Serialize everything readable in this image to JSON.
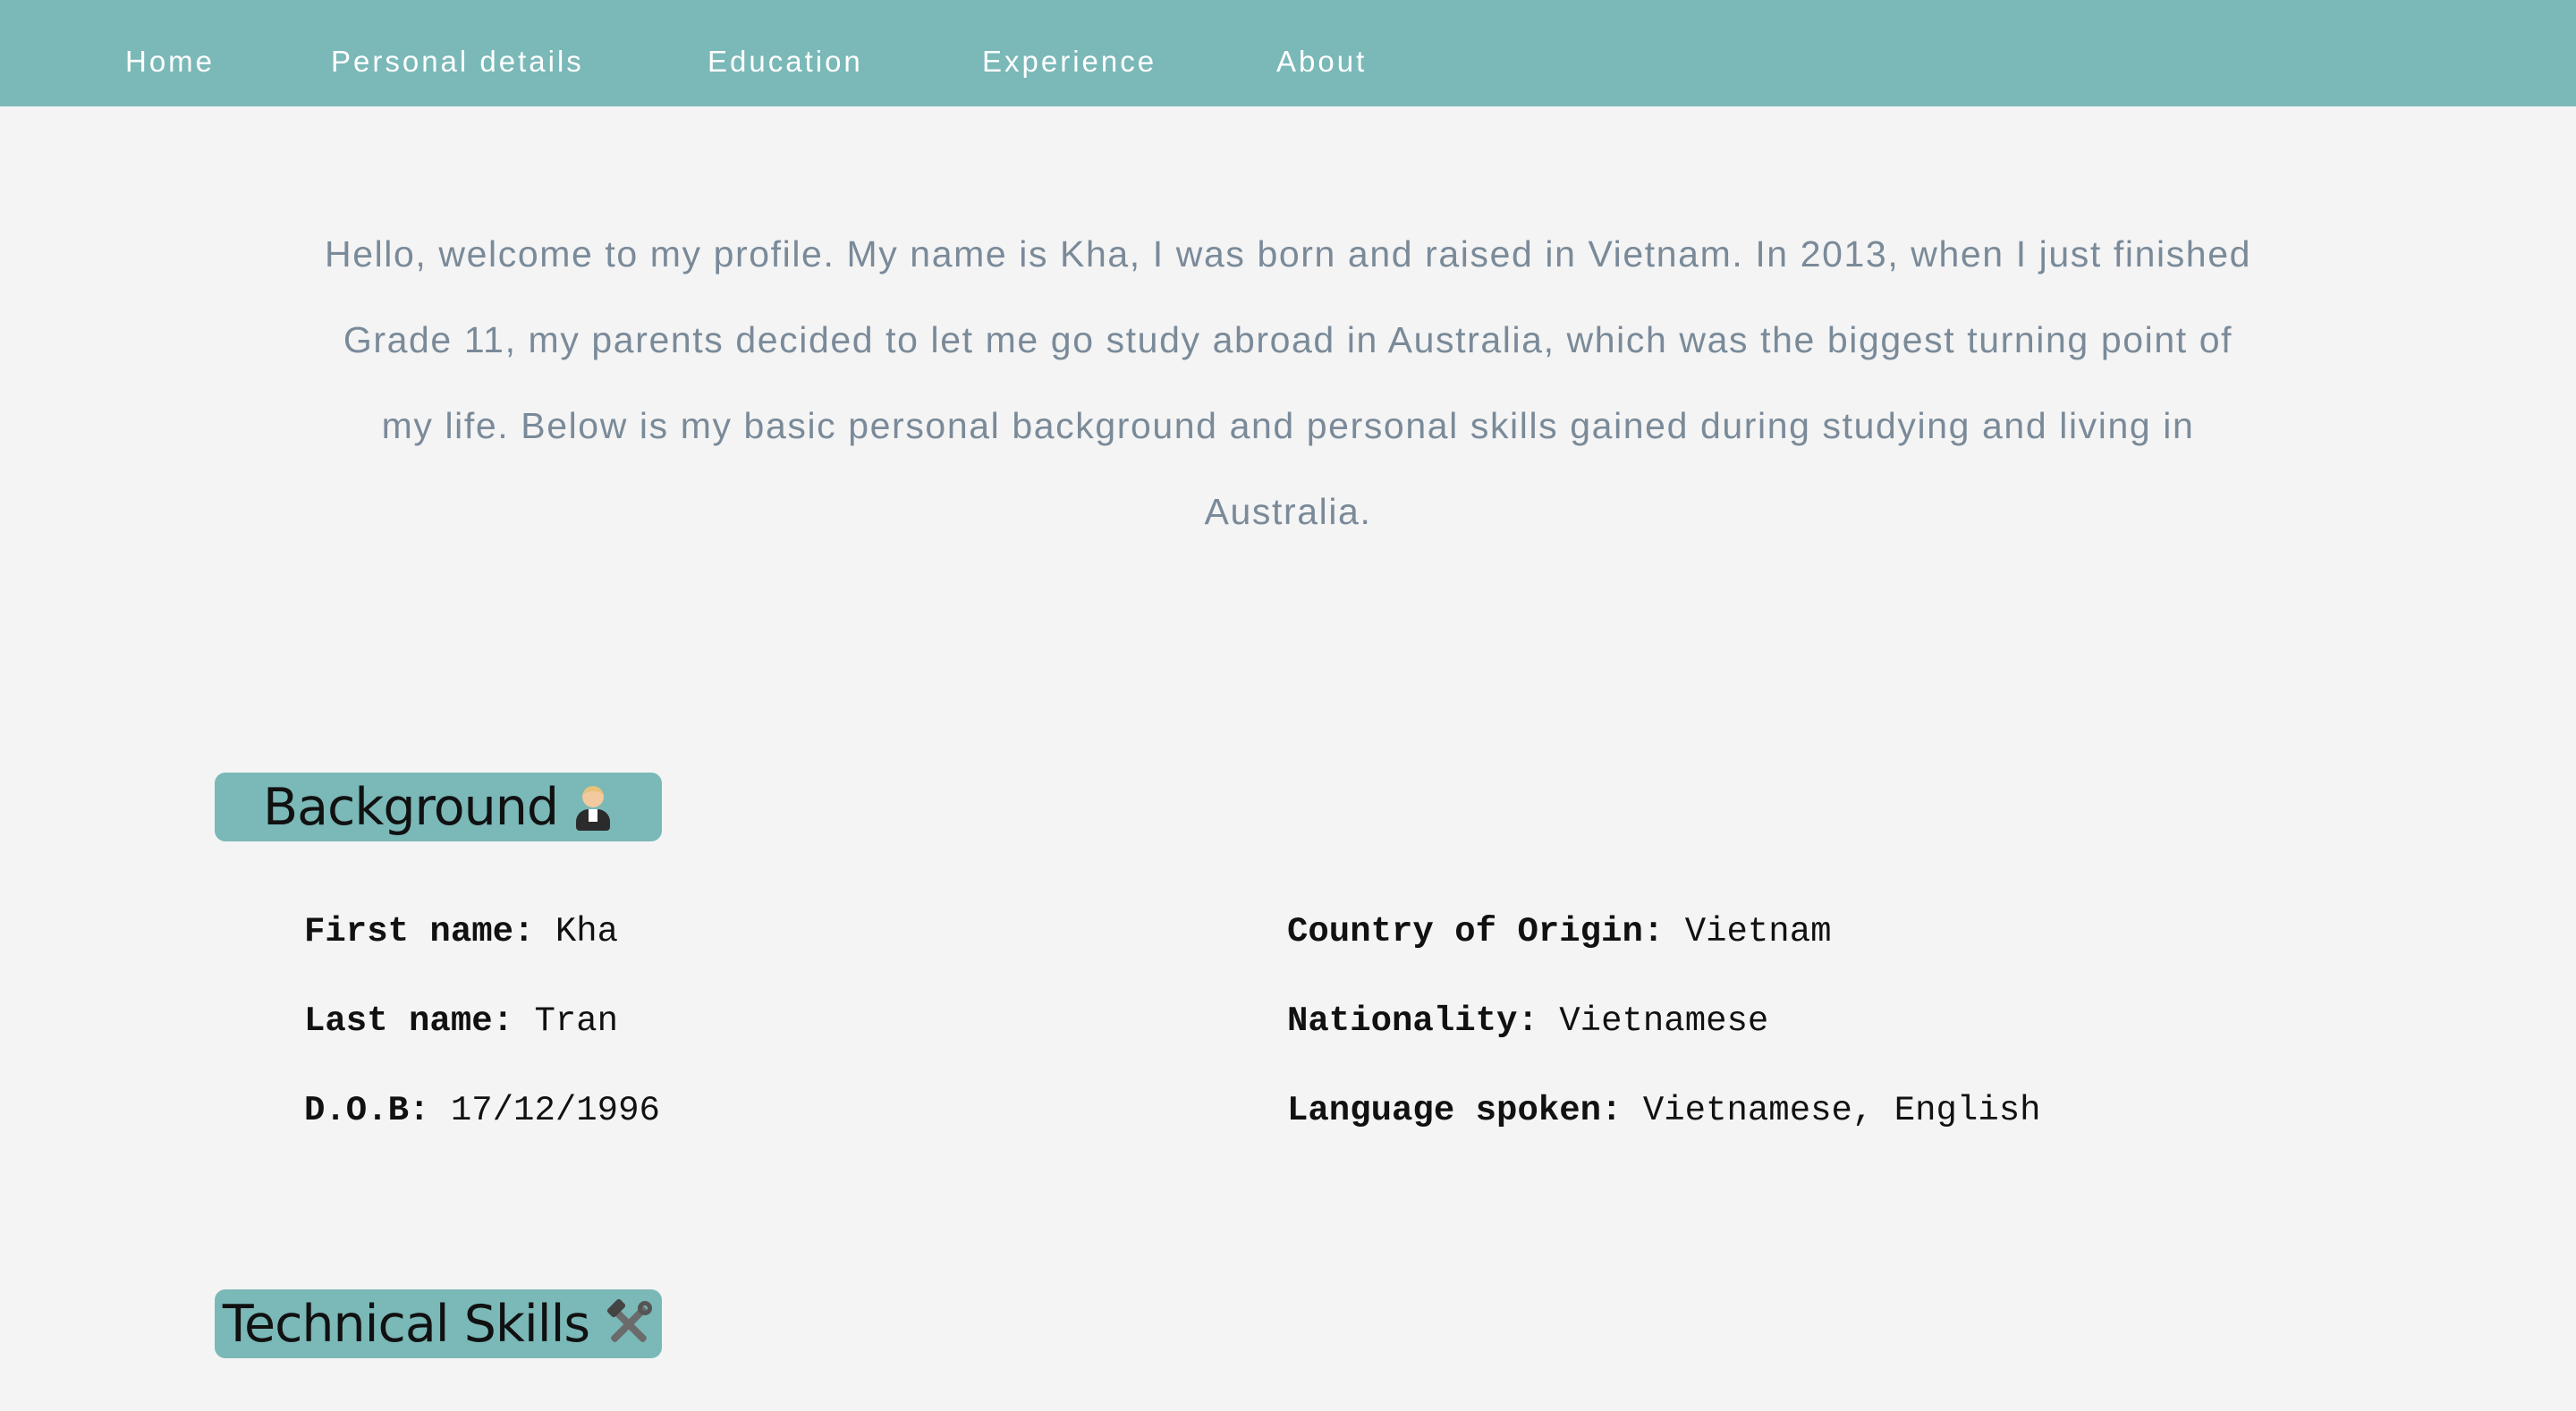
{
  "nav": {
    "items": [
      {
        "label": "Home"
      },
      {
        "label": "Personal details"
      },
      {
        "label": "Education"
      },
      {
        "label": "Experience"
      },
      {
        "label": "About"
      }
    ],
    "background_color": "#7bb8b8"
  },
  "intro": {
    "text": "Hello, welcome to my profile. My name is Kha, I was born and raised in Vietnam. In 2013, when I just finished Grade 11, my parents decided to let me go study abroad in Australia, which was the biggest turning point of my life. Below is my basic personal background and personal skills gained during studying and living in Australia."
  },
  "background": {
    "title": "Background",
    "icon": "person-in-tuxedo-icon",
    "left": [
      {
        "label": "First name:",
        "value": "Kha"
      },
      {
        "label": "Last name:",
        "value": "Tran"
      },
      {
        "label": "D.O.B:",
        "value": "17/12/1996"
      }
    ],
    "right": [
      {
        "label": "Country of Origin:",
        "value": "Vietnam"
      },
      {
        "label": "Nationality:",
        "value": "Vietnamese"
      },
      {
        "label": "Language spoken:",
        "value": "Vietnamese, English"
      }
    ]
  },
  "technical_skills": {
    "title": "Technical Skills",
    "icon": "hammer-and-wrench-icon"
  },
  "colors": {
    "accent": "#7bb8b8",
    "page_background": "#f4f4f4",
    "intro_text": "#7a8a99"
  }
}
